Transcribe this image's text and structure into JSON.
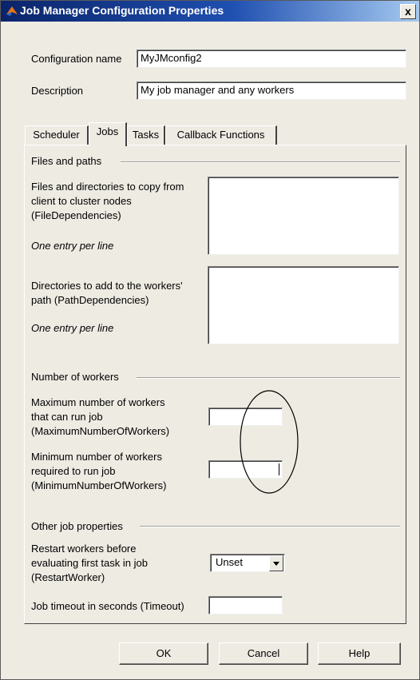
{
  "window": {
    "title": "Job Manager Configuration Properties",
    "close_label": "x"
  },
  "config": {
    "name_label": "Configuration name",
    "name_value": "MyJMconfig2",
    "description_label": "Description",
    "description_value": "My job manager and any workers"
  },
  "tabs": [
    {
      "label": "Scheduler"
    },
    {
      "label": "Jobs"
    },
    {
      "label": "Tasks"
    },
    {
      "label": "Callback Functions"
    }
  ],
  "jobs": {
    "files_section": "Files and paths",
    "file_deps_label": [
      "Files and directories to copy from",
      "client to cluster nodes",
      "(FileDependencies)"
    ],
    "file_deps_hint": "One entry per line",
    "path_deps_label": [
      "Directories to add to the workers'",
      "path (PathDependencies)"
    ],
    "path_deps_hint": "One entry per line",
    "workers_section": "Number of workers",
    "max_workers_label": [
      "Maximum number of workers",
      "that can run job",
      "(MaximumNumberOfWorkers)"
    ],
    "max_workers_value": "",
    "min_workers_label": [
      "Minimum number of workers",
      "required to run job",
      "(MinimumNumberOfWorkers)"
    ],
    "min_workers_value": "",
    "other_section": "Other job properties",
    "restart_label": [
      "Restart workers before",
      "evaluating first task in job",
      "(RestartWorker)"
    ],
    "restart_value": "Unset",
    "timeout_label": "Job timeout in seconds (Timeout)",
    "timeout_value": ""
  },
  "buttons": {
    "ok": "OK",
    "cancel": "Cancel",
    "help": "Help"
  }
}
